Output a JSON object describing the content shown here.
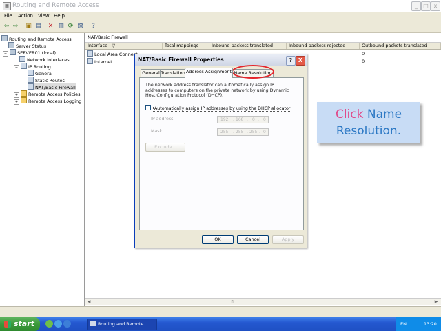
{
  "window": {
    "title": "Routing and Remote Access",
    "controls": {
      "minimize": "_",
      "maximize": "□",
      "close": "x"
    }
  },
  "menu": {
    "items": [
      "File",
      "Action",
      "View",
      "Help"
    ]
  },
  "toolbar": {
    "icons": [
      "back-arrow-icon",
      "forward-arrow-icon",
      "up-folder-icon",
      "show-hide-tree-icon",
      "delete-icon",
      "properties-icon",
      "refresh-icon",
      "export-list-icon",
      "help-icon"
    ]
  },
  "tree": {
    "items": [
      {
        "label": "Routing and Remote Access"
      },
      {
        "label": "Server Status"
      },
      {
        "label": "SERVER01 (local)"
      },
      {
        "label": "Network Interfaces"
      },
      {
        "label": "IP Routing"
      },
      {
        "label": "General"
      },
      {
        "label": "Static Routes"
      },
      {
        "label": "NAT/Basic Firewall"
      },
      {
        "label": "Remote Access Policies"
      },
      {
        "label": "Remote Access Logging"
      }
    ]
  },
  "list": {
    "title": "NAT/Basic Firewall",
    "columns": [
      "Interface",
      "Total mappings",
      "Inbound packets translated",
      "Inbound packets rejected",
      "Outbound packets translated"
    ],
    "sort_indicator": "▽",
    "rows": [
      {
        "interface": "Local Area Connect",
        "outbound": "0"
      },
      {
        "interface": "Internet",
        "outbound": "0"
      }
    ]
  },
  "dialog": {
    "title": "NAT/Basic Firewall Properties",
    "help_label": "?",
    "close_label": "X",
    "tabs": [
      "General",
      "Translation",
      "Address Assignment",
      "Name Resolution"
    ],
    "active_tab": "Address Assignment",
    "description": "The network address translator can automatically assign IP addresses to computers on the private network by using Dynamic Host Configuration Protocol (DHCP).",
    "checkbox_label": "Automatically assign IP addresses by using the DHCP allocator",
    "ip_address_label": "IP address:",
    "ip_address_value": [
      "192",
      "168",
      "0",
      "0"
    ],
    "mask_label": "Mask:",
    "mask_value": [
      "255",
      "255",
      "255",
      "0"
    ],
    "exclude_button": "Exclude...",
    "ok_button": "OK",
    "cancel_button": "Cancel",
    "apply_button": "Apply"
  },
  "callout": {
    "word1": "Click",
    "word2": "Name",
    "line2": "Resolution."
  },
  "taskbar": {
    "start_label": "start",
    "task_label": "Routing and Remote ...",
    "language": "EN",
    "clock": "13:20"
  },
  "colors": {
    "highlight": "#e4252b",
    "callout_bg": "#c8dcf5",
    "callout_text": "#2c78c4",
    "callout_accent": "#e04a8a",
    "taskbar": "#2458d0",
    "start_button": "#3b9a3b"
  }
}
